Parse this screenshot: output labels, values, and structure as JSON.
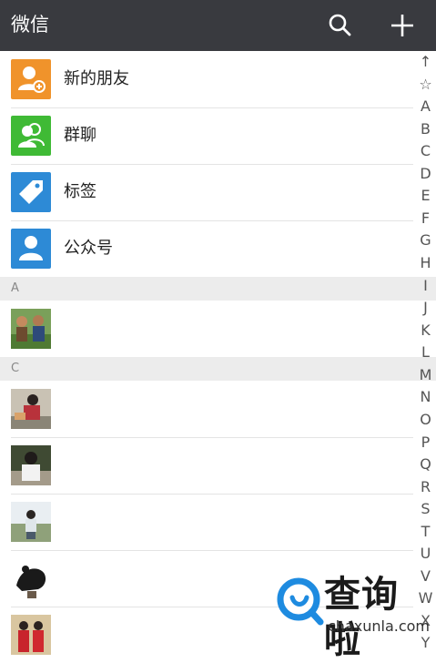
{
  "header": {
    "title": "微信",
    "search_icon": "search-icon",
    "add_icon": "plus-icon"
  },
  "functions": [
    {
      "label": "新的朋友",
      "icon": "add-friend-icon",
      "color": "#f0932b"
    },
    {
      "label": "群聊",
      "icon": "group-chat-icon",
      "color": "#3fba35"
    },
    {
      "label": "标签",
      "icon": "tag-icon",
      "color": "#2d8ad6"
    },
    {
      "label": "公众号",
      "icon": "official-account-icon",
      "color": "#2d8ad6"
    }
  ],
  "sections": [
    {
      "letter": "A",
      "contacts": [
        {
          "avatar": "photo-avatar"
        }
      ]
    },
    {
      "letter": "C",
      "contacts": [
        {
          "avatar": "photo-avatar"
        },
        {
          "avatar": "photo-avatar"
        },
        {
          "avatar": "photo-avatar"
        },
        {
          "avatar": "photo-avatar"
        },
        {
          "avatar": "photo-avatar"
        }
      ]
    }
  ],
  "index_bar": [
    "↑",
    "☆",
    "A",
    "B",
    "C",
    "D",
    "E",
    "F",
    "G",
    "H",
    "I",
    "J",
    "K",
    "L",
    "M",
    "N",
    "O",
    "P",
    "Q",
    "R",
    "S",
    "T",
    "U",
    "V",
    "W",
    "X",
    "Y"
  ],
  "watermark": {
    "title": "查询啦",
    "url": "chaxunla.com",
    "color": "#1e8be0"
  }
}
